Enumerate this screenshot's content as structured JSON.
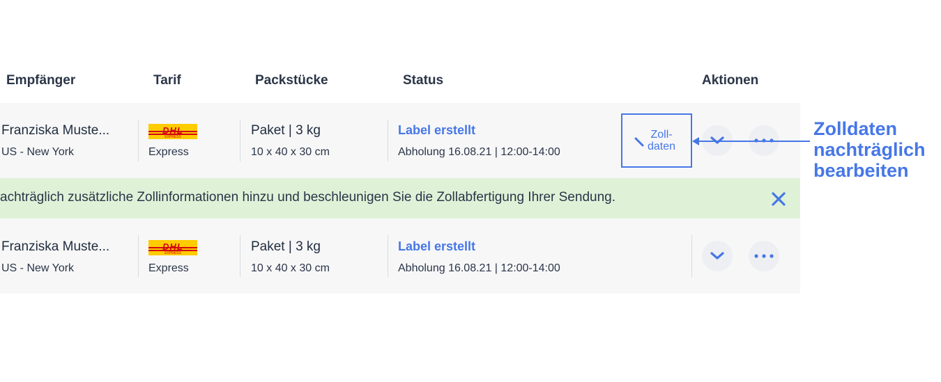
{
  "table": {
    "headers": {
      "recipient": "Empfänger",
      "tariff": "Tarif",
      "packages": "Packstücke",
      "status": "Status",
      "actions": "Aktionen"
    },
    "rows": [
      {
        "recipient_name": "Franziska Muste...",
        "recipient_location": "US - New York",
        "carrier_logo": "DHL",
        "carrier_logo_sub": "EXPRESS",
        "tariff": "Express",
        "package_summary": "Paket | 3 kg",
        "package_dims": "10 x 40 x 30 cm",
        "status": "Label erstellt",
        "pickup": "Abholung 16.08.21 | 12:00-14:00",
        "customs_button_line1": "Zoll-",
        "customs_button_line2": "daten"
      },
      {
        "recipient_name": "Franziska Muste...",
        "recipient_location": "US - New York",
        "carrier_logo": "DHL",
        "carrier_logo_sub": "EXPRESS",
        "tariff": "Express",
        "package_summary": "Paket | 3 kg",
        "package_dims": "10 x 40 x 30 cm",
        "status": "Label erstellt",
        "pickup": "Abholung 16.08.21 | 12:00-14:00"
      }
    ]
  },
  "banner": {
    "message": "achträglich zusätzliche Zollinformationen hinzu und beschleunigen Sie die Zollabfertigung Ihrer Sendung."
  },
  "annotation": {
    "line1": "Zolldaten",
    "line2": "nachträglich",
    "line3": "bearbeiten"
  },
  "icons": {
    "expand": "chevron-down-icon",
    "more": "more-dots-icon",
    "edit": "pencil-icon",
    "close": "close-icon"
  },
  "colors": {
    "accent": "#4677e6",
    "row_bg": "#f7f7f8",
    "banner_bg": "#dff2d8",
    "dhl_yellow": "#ffcc00",
    "dhl_red": "#d40511"
  }
}
